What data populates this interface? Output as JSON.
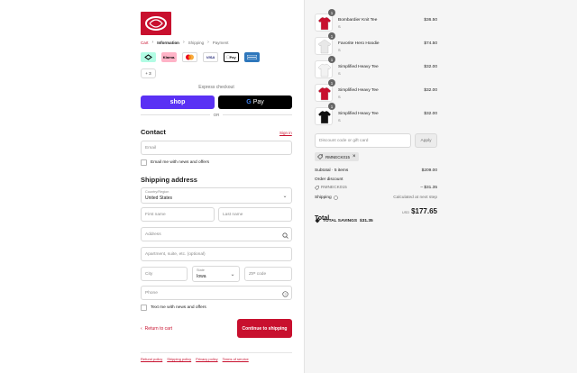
{
  "breadcrumb": {
    "items": [
      "Cart",
      "Information",
      "Shipping",
      "Payment"
    ]
  },
  "payments": {
    "methods": [
      "afterpay-icon",
      "klarna",
      "mastercard-icon",
      "VISA",
      "Apple Pay",
      "amex-icon"
    ],
    "klarna_label": "Klarna.",
    "visa_label": "VISA",
    "applepay_label": "Pay",
    "more_label": "+ 3"
  },
  "express": {
    "label": "Express checkout",
    "shop_label": "shop",
    "gpay_label": "Pay",
    "or_label": "OR"
  },
  "contact": {
    "title": "Contact",
    "signin_label": "Sign in",
    "email_placeholder": "Email",
    "news_label": "Email me with news and offers"
  },
  "shipping": {
    "title": "Shipping address",
    "country_label": "Country/Region",
    "country_value": "United States",
    "first_name": "First name",
    "last_name": "Last name",
    "address": "Address",
    "apartment": "Apartment, suite, etc. (optional)",
    "city": "City",
    "state_label": "State",
    "state_value": "Iowa",
    "zip": "ZIP code",
    "phone": "Phone",
    "text_news_label": "Text me with news and offers"
  },
  "actions": {
    "return_label": "Return to cart",
    "continue_label": "Continue to shipping"
  },
  "footer": {
    "links": [
      "Refund policy",
      "Shipping policy",
      "Privacy policy",
      "Terms of service"
    ]
  },
  "order": {
    "items": [
      {
        "name": "Bombardier Knit Tee",
        "size": "S",
        "price": "$36.50",
        "qty": "1",
        "color": "#c8102e"
      },
      {
        "name": "Favorite Hero Hoodie",
        "size": "S",
        "price": "$74.50",
        "qty": "1",
        "color": "#e8e8e8"
      },
      {
        "name": "Simplified Heavy Tee",
        "size": "S",
        "price": "$32.00",
        "qty": "1",
        "color": "#f2f2f2"
      },
      {
        "name": "Simplified Heavy Tee",
        "size": "S",
        "price": "$32.00",
        "qty": "1",
        "color": "#c8102e"
      },
      {
        "name": "Simplified Heavy Tee",
        "size": "S",
        "price": "$32.00",
        "qty": "1",
        "color": "#111111"
      }
    ],
    "discount_placeholder": "Discount code or gift card",
    "apply_label": "Apply",
    "applied_code": "RMNECK015",
    "subtotal_label": "Subtotal · 5 items",
    "subtotal_value": "$209.00",
    "order_discount_label": "Order discount",
    "discount_code": "RMNECK015",
    "discount_value": "– $31.35",
    "shipping_label": "Shipping",
    "shipping_value": "Calculated at next step",
    "total_label": "Total",
    "total_currency": "USD",
    "total_value": "$177.65",
    "savings_label": "TOTAL SAVINGS",
    "savings_value": "$31.35"
  },
  "colors": {
    "brand": "#c8102e",
    "shop_pay": "#5a31f4",
    "gpay": "#000000"
  }
}
